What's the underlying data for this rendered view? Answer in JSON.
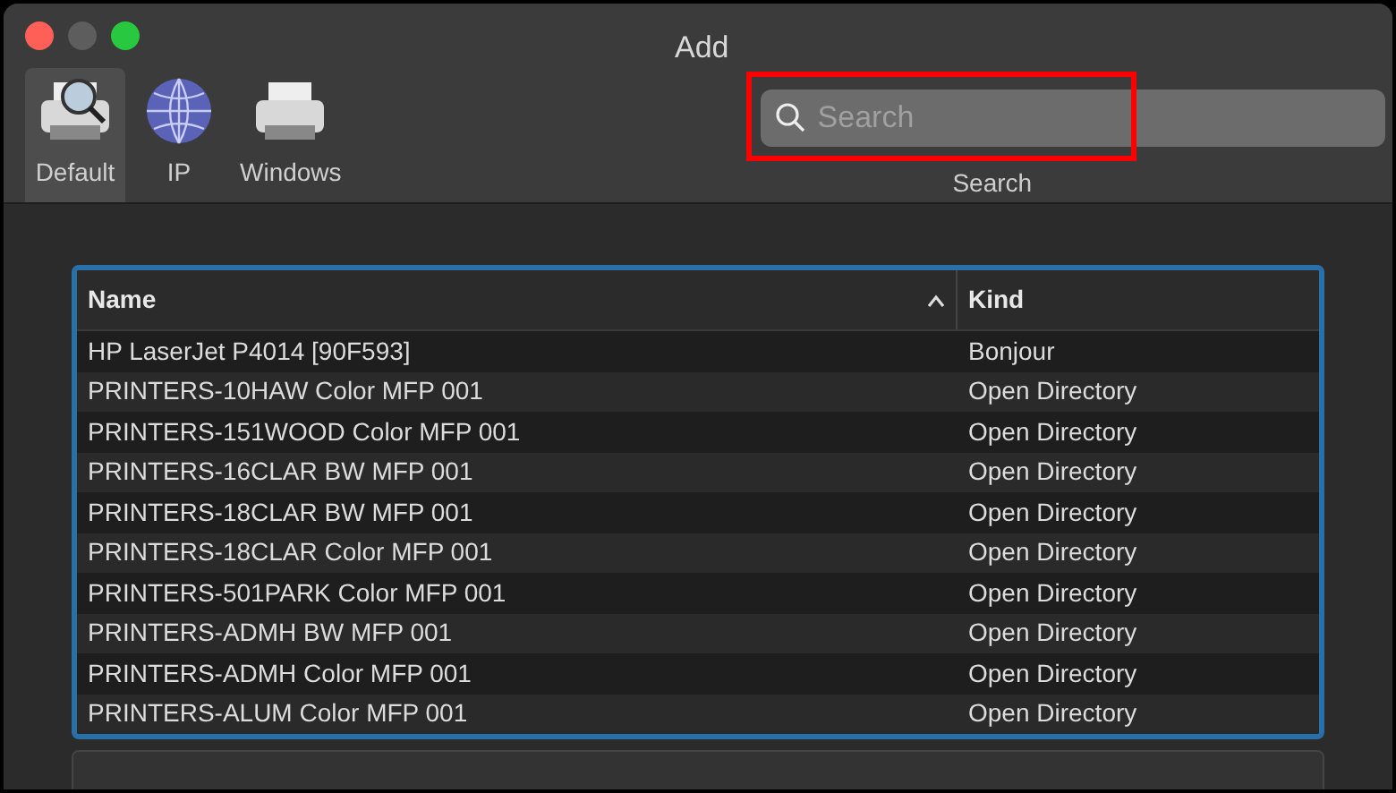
{
  "window": {
    "title": "Add"
  },
  "toolbar": [
    {
      "label": "Default",
      "kind": "default",
      "selected": true
    },
    {
      "label": "IP",
      "kind": "ip",
      "selected": false
    },
    {
      "label": "Windows",
      "kind": "windows",
      "selected": false
    }
  ],
  "search": {
    "placeholder": "Search",
    "label": "Search",
    "highlighted": true
  },
  "table": {
    "columns": [
      {
        "label": "Name",
        "sorted": true
      },
      {
        "label": "Kind",
        "sorted": false
      }
    ],
    "rows": [
      [
        "HP LaserJet P4014 [90F593]",
        "Bonjour"
      ],
      [
        "PRINTERS-10HAW Color MFP 001",
        "Open Directory"
      ],
      [
        "PRINTERS-151WOOD Color MFP 001",
        "Open Directory"
      ],
      [
        "PRINTERS-16CLAR BW MFP 001",
        "Open Directory"
      ],
      [
        "PRINTERS-18CLAR BW MFP 001",
        "Open Directory"
      ],
      [
        "PRINTERS-18CLAR Color MFP 001",
        "Open Directory"
      ],
      [
        "PRINTERS-501PARK Color MFP 001",
        "Open Directory"
      ],
      [
        "PRINTERS-ADMH BW MFP 001",
        "Open Directory"
      ],
      [
        "PRINTERS-ADMH Color MFP 001",
        "Open Directory"
      ],
      [
        "PRINTERS-ALUM Color MFP 001",
        "Open Directory"
      ]
    ]
  }
}
